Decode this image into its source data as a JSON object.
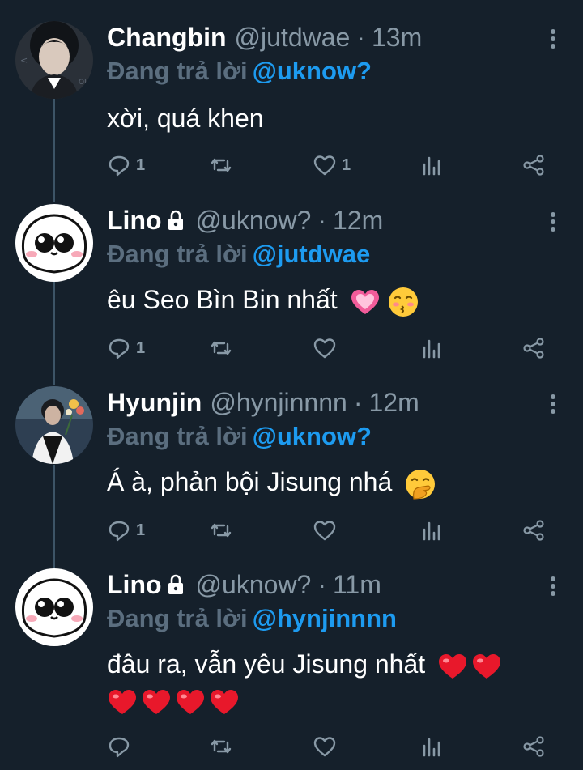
{
  "colors": {
    "background": "#15202b",
    "muted": "#8899a6",
    "mention": "#1d9bf0",
    "thread_line": "#3d5466"
  },
  "tweets": [
    {
      "name": "Changbin",
      "handle": "@jutdwae",
      "separator": "·",
      "time": "13m",
      "locked": false,
      "reply_prefix": "Đang trả lời",
      "reply_to": "@uknow?",
      "text": "xời, quá khen",
      "reply_count": "1",
      "like_count": "1",
      "avatar": "photo-avatar-changbin"
    },
    {
      "name": "Lino",
      "handle": "@uknow?",
      "separator": "·",
      "time": "12m",
      "locked": true,
      "reply_prefix": "Đang trả lời",
      "reply_to": "@jutdwae",
      "text": "êu Seo Bìn Bin nhất",
      "emojis": [
        "sparkling-heart",
        "kissing-face"
      ],
      "reply_count": "1",
      "like_count": "",
      "avatar": "cartoon-avatar-lino"
    },
    {
      "name": "Hyunjin",
      "handle": "@hynjinnnn",
      "separator": "·",
      "time": "12m",
      "locked": false,
      "reply_prefix": "Đang trả lời",
      "reply_to": "@uknow?",
      "text": "Á à, phản bội Jisung nhá",
      "emojis": [
        "hand-over-mouth-face"
      ],
      "reply_count": "1",
      "like_count": "",
      "avatar": "photo-avatar-hyunjin"
    },
    {
      "name": "Lino",
      "handle": "@uknow?",
      "separator": "·",
      "time": "11m",
      "locked": true,
      "reply_prefix": "Đang trả lời",
      "reply_to": "@hynjinnnn",
      "text": "đâu ra, vẫn yêu Jisung nhất",
      "emojis": [
        "red-heart",
        "red-heart",
        "red-heart",
        "red-heart",
        "red-heart",
        "red-heart"
      ],
      "reply_count": "",
      "like_count": "",
      "avatar": "cartoon-avatar-lino"
    }
  ]
}
